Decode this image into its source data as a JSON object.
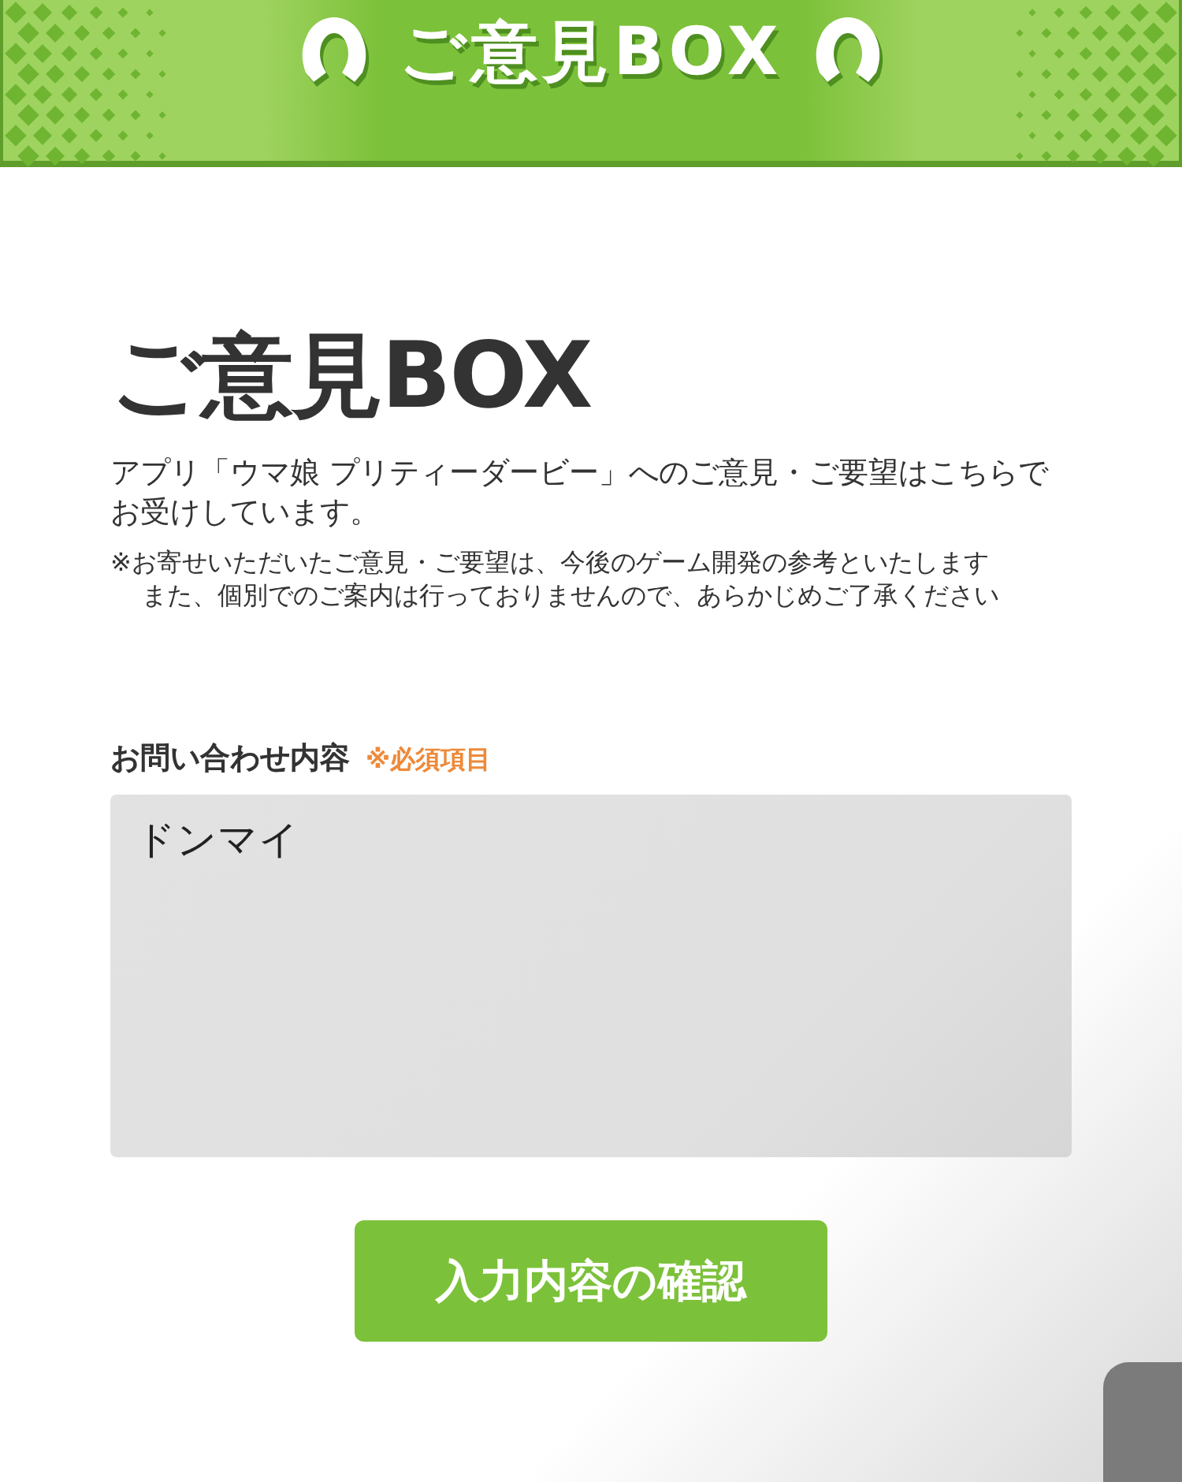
{
  "banner": {
    "title": "ご意見BOX"
  },
  "heading": "ご意見BOX",
  "intro": "アプリ「ウマ娘 プリティーダービー」へのご意見・ご要望はこちらでお受けしています。",
  "notes": [
    "※お寄せいただいたご意見・ご要望は、今後のゲーム開発の参考といたします",
    "また、個別でのご案内は行っておりませんので、あらかじめご了承ください"
  ],
  "form": {
    "label": "お問い合わせ内容",
    "required": "※必須項目",
    "value": "ドンマイ"
  },
  "submit": "入力内容の確認"
}
